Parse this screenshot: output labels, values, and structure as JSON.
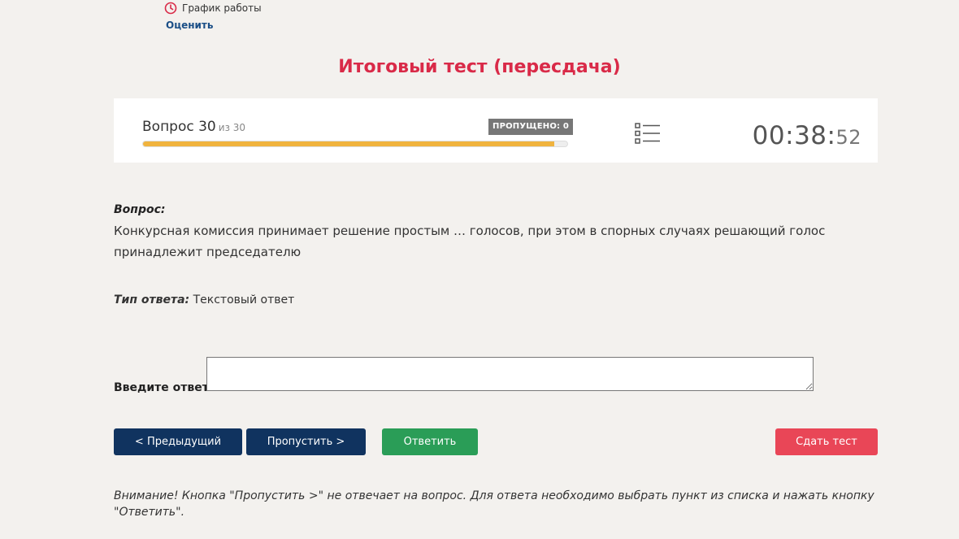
{
  "top": {
    "schedule_label": "График работы",
    "rate_label": "Оценить"
  },
  "page_title": "Итоговый тест (пересдача)",
  "status": {
    "question_label": "Вопрос 30",
    "question_of": "из 30",
    "skipped_badge": "ПРОПУЩЕНО: 0",
    "progress_fraction": 0.97,
    "timer_main": "00:38:",
    "timer_seconds": "52"
  },
  "question": {
    "label": "Вопрос:",
    "text": "Конкурсная комиссия принимает решение простым … голосов, при этом в спорных случаях решающий голос принадлежит председателю"
  },
  "answer_type": {
    "label": "Тип ответа:",
    "value": "Текстовый ответ"
  },
  "answer": {
    "label": "Введите ответ:",
    "value": ""
  },
  "buttons": {
    "prev": "< Предыдущий",
    "skip": "Пропустить >",
    "answer": "Ответить",
    "submit": "Сдать тест"
  },
  "note": "Внимание! Кнопка \"Пропустить >\" не отвечает на вопрос. Для ответа необходимо выбрать пункт из списка и нажать кнопку \"Ответить\".",
  "colors": {
    "title": "#d92a48",
    "primary_button": "#10335f",
    "answer_button": "#2a9d57",
    "submit_button": "#e94657",
    "progress": "#f0b33e"
  }
}
